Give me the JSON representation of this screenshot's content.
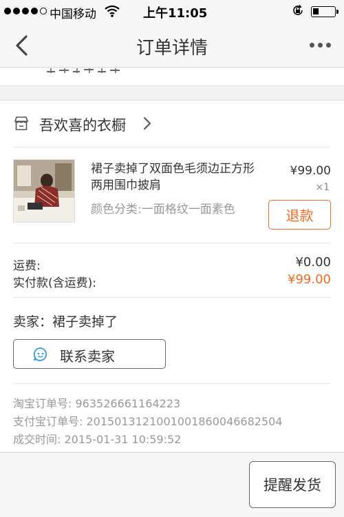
{
  "status_bar": {
    "carrier": "中国移动",
    "time": "上午11:05"
  },
  "nav": {
    "title": "订单详情",
    "back_icon": "chevron-left-icon",
    "more_icon": "more-dots-icon"
  },
  "shop": {
    "name": "吾欢喜的衣橱",
    "icon": "store-icon"
  },
  "item": {
    "title": "裙子卖掉了双面色毛须边正方形两用围巾披肩",
    "spec": "颜色分类:一面格纹一面素色",
    "price": "¥99.00",
    "quantity": "×1",
    "refund_label": "退款"
  },
  "fees": {
    "shipping_label": "运费:",
    "shipping_value": "¥0.00",
    "paid_label": "实付款(含运费):",
    "paid_value": "¥99.00"
  },
  "seller": {
    "line": "卖家：裙子卖掉了",
    "contact_label": "联系卖家",
    "contact_icon": "chat-smile-icon"
  },
  "order_meta": {
    "taobao_order": "淘宝订单号: 963526661164223",
    "alipay_order": "支付宝订单号: 2015013121001001860046682504",
    "deal_time": "成交时间: 2015-01-31 10:59:52"
  },
  "bottom": {
    "remind_label": "提醒发货"
  },
  "colors": {
    "accent": "#f06a20",
    "muted_text": "#999999",
    "background": "#f2f2f2"
  }
}
